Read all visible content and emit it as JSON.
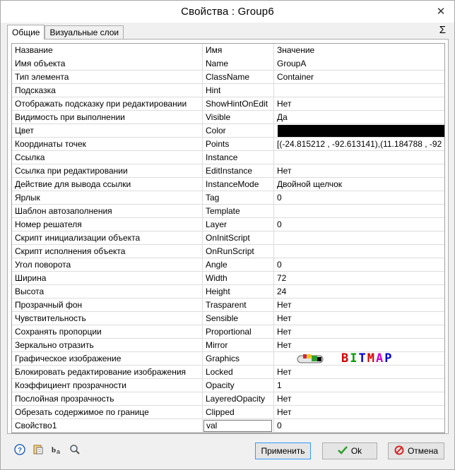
{
  "window": {
    "title": "Свойства :   Group6",
    "close_glyph": "✕"
  },
  "tabs": [
    {
      "label": "Общие",
      "active": true
    },
    {
      "label": "Визуальные слои",
      "active": false
    }
  ],
  "sigma_glyph": "Σ",
  "grid": {
    "headers": {
      "name": "Название",
      "id": "Имя",
      "value": "Значение"
    },
    "rows": [
      {
        "name": "Имя объекта",
        "id": "Name",
        "value": "GroupA"
      },
      {
        "name": "Тип элемента",
        "id": "ClassName",
        "value": "Container"
      },
      {
        "name": "Подсказка",
        "id": "Hint",
        "value": ""
      },
      {
        "name": "Отображать подсказку при редактировании",
        "id": "ShowHintOnEdit",
        "value": "Нет"
      },
      {
        "name": "Видимость при выполнении",
        "id": "Visible",
        "value": "Да"
      },
      {
        "name": "Цвет",
        "id": "Color",
        "value": ""
      },
      {
        "name": "Координаты точек",
        "id": "Points",
        "value": "[(-24.815212 , -92.613141),(11.184788 , -92"
      },
      {
        "name": "Ссылка",
        "id": "Instance",
        "value": ""
      },
      {
        "name": "Ссылка при редактировании",
        "id": "EditInstance",
        "value": "Нет"
      },
      {
        "name": "Действие для вывода ссылки",
        "id": "InstanceMode",
        "value": "Двойной щелчок"
      },
      {
        "name": "Ярлык",
        "id": "Tag",
        "value": "0"
      },
      {
        "name": "Шаблон автозаполнения",
        "id": "Template",
        "value": ""
      },
      {
        "name": "Номер решателя",
        "id": "Layer",
        "value": "0"
      },
      {
        "name": "Скрипт инициализации объекта",
        "id": "OnInitScript",
        "value": ""
      },
      {
        "name": "Скрипт исполнения объекта",
        "id": "OnRunScript",
        "value": ""
      },
      {
        "name": "Угол поворота",
        "id": "Angle",
        "value": "0"
      },
      {
        "name": "Ширина",
        "id": "Width",
        "value": "72"
      },
      {
        "name": "Высота",
        "id": "Height",
        "value": "24"
      },
      {
        "name": "Прозрачный фон",
        "id": "Trasparent",
        "value": "Нет"
      },
      {
        "name": "Чувствительность",
        "id": "Sensible",
        "value": "Нет"
      },
      {
        "name": "Сохранять пропорции",
        "id": "Proportional",
        "value": "Нет"
      },
      {
        "name": "Зеркально отразить",
        "id": "Mirror",
        "value": "Нет"
      },
      {
        "name": "Графическое изображение",
        "id": "Graphics",
        "value": ""
      },
      {
        "name": "Блокировать редактирование изображения",
        "id": "Locked",
        "value": "Нет"
      },
      {
        "name": "Коэффициент прозрачности",
        "id": "Opacity",
        "value": "1"
      },
      {
        "name": "Послойная прозрачность",
        "id": "LayeredOpacity",
        "value": "Нет"
      },
      {
        "name": "Обрезать содержимое по границе",
        "id": "Clipped",
        "value": "Нет"
      },
      {
        "name": "Свойство1",
        "id": "val",
        "value": "0"
      }
    ],
    "color_value": "#000000",
    "graphics_text": "BITMAP"
  },
  "footer_icons": [
    "help-icon",
    "properties-icon",
    "font-icon",
    "search-icon"
  ],
  "buttons": {
    "apply": "Применить",
    "ok": "Ok",
    "cancel": "Отмена"
  }
}
